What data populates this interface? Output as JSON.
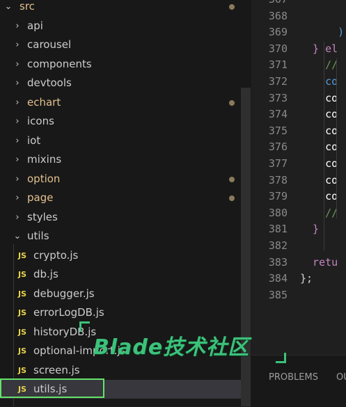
{
  "explorer": {
    "root": {
      "label": "src",
      "modified": true
    },
    "folders": [
      {
        "label": "api",
        "modified": false
      },
      {
        "label": "carousel",
        "modified": false
      },
      {
        "label": "components",
        "modified": false
      },
      {
        "label": "devtools",
        "modified": false
      },
      {
        "label": "echart",
        "modified": true
      },
      {
        "label": "icons",
        "modified": false
      },
      {
        "label": "iot",
        "modified": false
      },
      {
        "label": "mixins",
        "modified": false
      },
      {
        "label": "option",
        "modified": true
      },
      {
        "label": "page",
        "modified": true
      },
      {
        "label": "styles",
        "modified": false
      }
    ],
    "open_folder": {
      "label": "utils"
    },
    "files": [
      {
        "icon": "JS",
        "label": "crypto.js"
      },
      {
        "icon": "JS",
        "label": "db.js"
      },
      {
        "icon": "JS",
        "label": "debugger.js"
      },
      {
        "icon": "JS",
        "label": "errorLogDB.js"
      },
      {
        "icon": "JS",
        "label": "historyDB.js"
      },
      {
        "icon": "JS",
        "label": "optional-import.js"
      },
      {
        "icon": "JS",
        "label": "screen.js"
      },
      {
        "icon": "JS",
        "label": "utils.js"
      }
    ],
    "selected_file": "utils.js"
  },
  "editor": {
    "lines": [
      {
        "num": "367",
        "code": "",
        "color": "#d4d4d4"
      },
      {
        "num": "368",
        "code": "",
        "color": "#d4d4d4"
      },
      {
        "num": "369",
        "code": "      )",
        "color": "#569cd6"
      },
      {
        "num": "370",
        "code": "  } el",
        "color": "#c586c0"
      },
      {
        "num": "371",
        "code": "    //",
        "color": "#6a9955"
      },
      {
        "num": "372",
        "code": "    co",
        "color": "#569cd6"
      },
      {
        "num": "373",
        "code": "    co",
        "color": "#ffffff"
      },
      {
        "num": "374",
        "code": "    co",
        "color": "#ffffff"
      },
      {
        "num": "375",
        "code": "    co",
        "color": "#ffffff"
      },
      {
        "num": "376",
        "code": "    co",
        "color": "#ffffff"
      },
      {
        "num": "377",
        "code": "    co",
        "color": "#ffffff"
      },
      {
        "num": "378",
        "code": "    co",
        "color": "#ffffff"
      },
      {
        "num": "379",
        "code": "    co",
        "color": "#ffffff"
      },
      {
        "num": "380",
        "code": "    //",
        "color": "#6a9955"
      },
      {
        "num": "381",
        "code": "  }",
        "color": "#c586c0"
      },
      {
        "num": "382",
        "code": "",
        "color": "#d4d4d4"
      },
      {
        "num": "383",
        "code": "  retu",
        "color": "#c586c0"
      },
      {
        "num": "384",
        "code": "};",
        "color": "#d4d4d4"
      },
      {
        "num": "385",
        "code": "",
        "color": "#d4d4d4"
      }
    ]
  },
  "panel": {
    "tabs": [
      "PROBLEMS",
      "OU"
    ]
  },
  "watermark": {
    "text": "Blade技术社区"
  },
  "colors": {
    "sidebar_bg": "#181818",
    "editor_bg": "#1f1f1f",
    "selection_bg": "#37373d",
    "modified_text": "#e2c08d",
    "highlight_border": "#66e26a",
    "js_icon": "#e8d44d"
  }
}
